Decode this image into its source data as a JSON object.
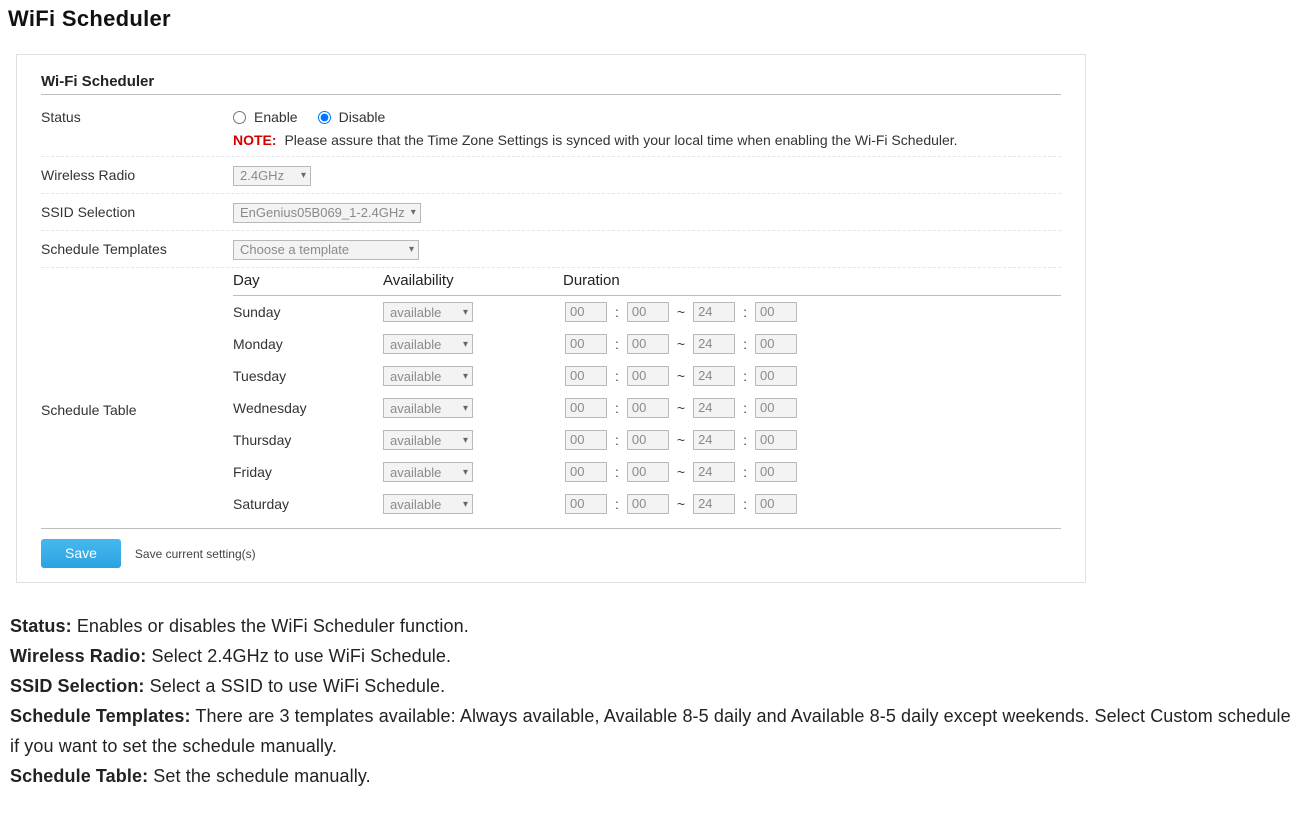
{
  "page": {
    "title": "WiFi Scheduler"
  },
  "panel": {
    "header": "Wi-Fi Scheduler",
    "status": {
      "label": "Status",
      "enable_label": "Enable",
      "disable_label": "Disable",
      "selected": "disable",
      "note_label": "NOTE:",
      "note_text": "Please assure that the Time Zone Settings is synced with your local time when enabling the Wi-Fi Scheduler."
    },
    "wireless_radio": {
      "label": "Wireless Radio",
      "value": "2.4GHz"
    },
    "ssid_selection": {
      "label": "SSID Selection",
      "value": "EnGenius05B069_1-2.4GHz"
    },
    "schedule_templates": {
      "label": "Schedule Templates",
      "value": "Choose a template"
    },
    "schedule_table": {
      "label": "Schedule Table",
      "columns": {
        "day": "Day",
        "availability": "Availability",
        "duration": "Duration"
      },
      "availability_option": "available",
      "rows": [
        {
          "day": "Sunday",
          "availability": "available",
          "sh": "00",
          "sm": "00",
          "eh": "24",
          "em": "00"
        },
        {
          "day": "Monday",
          "availability": "available",
          "sh": "00",
          "sm": "00",
          "eh": "24",
          "em": "00"
        },
        {
          "day": "Tuesday",
          "availability": "available",
          "sh": "00",
          "sm": "00",
          "eh": "24",
          "em": "00"
        },
        {
          "day": "Wednesday",
          "availability": "available",
          "sh": "00",
          "sm": "00",
          "eh": "24",
          "em": "00"
        },
        {
          "day": "Thursday",
          "availability": "available",
          "sh": "00",
          "sm": "00",
          "eh": "24",
          "em": "00"
        },
        {
          "day": "Friday",
          "availability": "available",
          "sh": "00",
          "sm": "00",
          "eh": "24",
          "em": "00"
        },
        {
          "day": "Saturday",
          "availability": "available",
          "sh": "00",
          "sm": "00",
          "eh": "24",
          "em": "00"
        }
      ],
      "colon": ":",
      "tilde": "~"
    },
    "save": {
      "button": "Save",
      "description": "Save current setting(s)"
    }
  },
  "descriptions": {
    "status_term": "Status:",
    "status_text": " Enables or disables the WiFi Scheduler function.",
    "wireless_term": "Wireless Radio:",
    "wireless_text": " Select 2.4GHz to use WiFi Schedule.",
    "ssid_term": "SSID Selection:",
    "ssid_text": " Select a SSID to use WiFi Schedule.",
    "templates_term": "Schedule Templates:",
    "templates_text": " There are 3 templates available: Always available, Available 8-5 daily and Available 8-5 daily except weekends. Select Custom schedule if you want to set the schedule manually.",
    "table_term": "Schedule Table:",
    "table_text": " Set the schedule manually."
  }
}
